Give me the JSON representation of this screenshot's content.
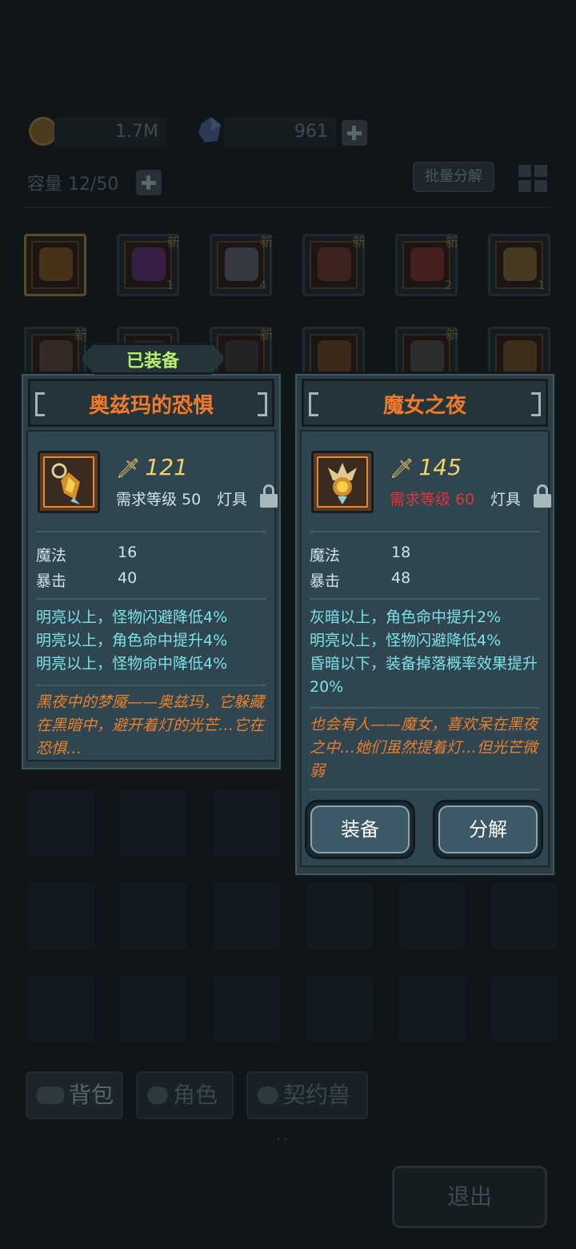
{
  "currency": {
    "gold": "1.7M",
    "gems": "961"
  },
  "inventory": {
    "capacity": "容量 12/50",
    "batch_label": "批量分解",
    "slots_row1": [
      {
        "new": "",
        "count": "",
        "color": "#6a4a1a"
      },
      {
        "new": "新",
        "count": "1",
        "color": "#4a2a6a"
      },
      {
        "new": "新",
        "count": "4",
        "color": "#4a5560"
      },
      {
        "new": "新",
        "count": "",
        "color": "#5a3028"
      },
      {
        "new": "新",
        "count": "2",
        "color": "#6a2a22"
      },
      {
        "new": "",
        "count": "1",
        "color": "#6a5a2a"
      }
    ],
    "slots_row2": [
      {
        "new": "新",
        "count": "",
        "color": "#4a3a30"
      },
      {
        "new": "",
        "count": "",
        "color": "#2a3034"
      },
      {
        "new": "新",
        "count": "",
        "color": "#2a3034"
      },
      {
        "new": "",
        "count": "",
        "color": "#5a3a22"
      },
      {
        "new": "新",
        "count": "",
        "color": "#3a4246"
      },
      {
        "new": "",
        "count": "",
        "color": "#5a4420"
      }
    ]
  },
  "tabs": [
    {
      "label": "背包"
    },
    {
      "label": "角色"
    },
    {
      "label": "契约兽"
    }
  ],
  "exit_label": "退出",
  "left_panel": {
    "badge": "已装备",
    "title": "奥兹玛的恐惧",
    "power": "121",
    "requirement": "需求等级 50",
    "slot_type": "灯具",
    "stats": [
      {
        "name": "魔法",
        "value": "16"
      },
      {
        "name": "暴击",
        "value": "40"
      }
    ],
    "effects": [
      "明亮以上，怪物闪避降低4%",
      "明亮以上，角色命中提升4%",
      "明亮以上，怪物命中降低4%"
    ],
    "lore": "黑夜中的梦魇——奥兹玛，它躲藏在黑暗中，避开着灯的光芒…它在恐惧…"
  },
  "right_panel": {
    "title": "魔女之夜",
    "power": "145",
    "requirement": "需求等级 60",
    "slot_type": "灯具",
    "stats": [
      {
        "name": "魔法",
        "value": "18"
      },
      {
        "name": "暴击",
        "value": "48"
      }
    ],
    "effects": [
      "灰暗以上，角色命中提升2%",
      "明亮以上，怪物闪避降低4%",
      "昏暗以下，装备掉落概率效果提升20%"
    ],
    "lore": "也会有人——魔女，喜欢呆在黑夜之中…她们虽然提着灯…但光芒微弱",
    "equip_label": "装备",
    "decompose_label": "分解"
  }
}
